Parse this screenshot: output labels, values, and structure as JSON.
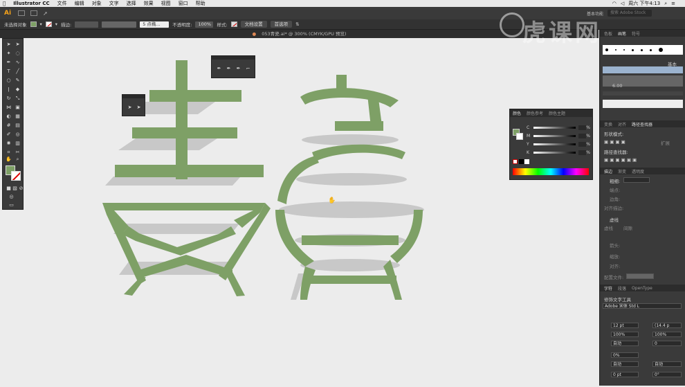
{
  "menubar": {
    "app": "Illustrator CC",
    "items": [
      "文件",
      "编辑",
      "对象",
      "文字",
      "选择",
      "效果",
      "视图",
      "窗口",
      "帮助"
    ],
    "clock": "周六 下午4:13"
  },
  "appbar": {
    "logo": "Ai",
    "workspace": "基本功能",
    "search_placeholder": "搜索 Adobe Stock"
  },
  "control_bar": {
    "selection_state": "未选择对象",
    "stroke_label": "描边:",
    "brush_preset": "5 点椭...",
    "opacity_label": "不透明度:",
    "opacity_value": "100%",
    "style_label": "样式:",
    "doc_setup_button": "文档设置",
    "preferences_button": "首选项"
  },
  "document_tab": {
    "title": "053青瓷.ai* @ 300% (CMYK/GPU 预览)"
  },
  "color_panel": {
    "tabs": [
      "颜色",
      "颜色参考",
      "颜色主题"
    ],
    "channels": [
      "C",
      "M",
      "Y",
      "K"
    ],
    "unit": "%",
    "fill_color": "#7ea066"
  },
  "right_panel": {
    "brush_header_tabs": [
      "色板",
      "画笔",
      "符号"
    ],
    "brush_label": "基本",
    "brush_size": "6.00",
    "pathfinder_tabs": [
      "变换",
      "对齐",
      "路径查找器"
    ],
    "shape_modes_label": "形状模式:",
    "expand_button": "扩展",
    "pathfinder_label": "路径查找器:",
    "stroke_tabs": [
      "描边",
      "渐变",
      "透明度"
    ],
    "weight_label": "粗细:",
    "cap_label": "端点:",
    "corner_label": "边角:",
    "align_stroke_label": "对齐描边:",
    "dashed_label": "虚线",
    "dash_label": "虚线",
    "gap_label": "间隙",
    "arrow_label": "箭头:",
    "scale_label": "缩放:",
    "align_label": "对齐:",
    "profile_label": "配置文件:",
    "char_tabs": [
      "字符",
      "段落",
      "OpenType"
    ],
    "touch_type": "修饰文字工具",
    "font_name": "Adobe 宋体 Std L",
    "font_size": "12 pt",
    "leading": "(14.4 p",
    "h_scale": "100%",
    "v_scale": "100%",
    "tracking_auto": "自动",
    "kern_value": "0",
    "baseline_value": "0%",
    "auto1": "自动",
    "auto2": "自动",
    "shift_pt": "0 pt",
    "rotation": "0°"
  },
  "watermark": {
    "text": "虎课网"
  }
}
